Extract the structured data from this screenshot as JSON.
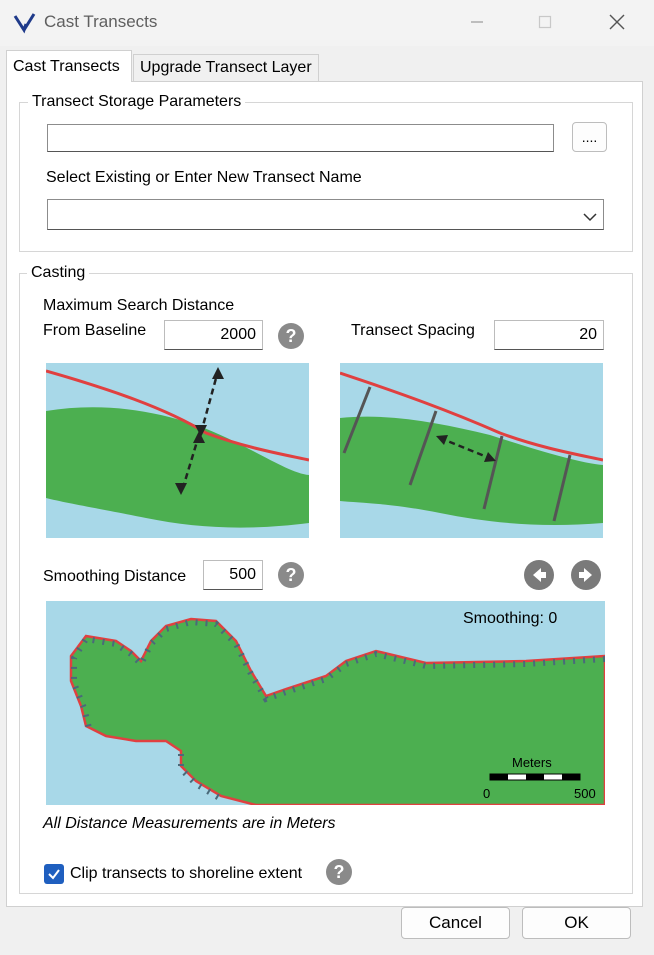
{
  "window": {
    "title": "Cast Transects",
    "app_icon": "dsas-logo-icon",
    "controls": [
      "minimize-icon",
      "maximize-icon",
      "close-icon"
    ]
  },
  "tabs": [
    {
      "label": "Cast Transects",
      "selected": true
    },
    {
      "label": "Upgrade Transect Layer",
      "selected": false
    }
  ],
  "storage": {
    "group_label": "Transect Storage Parameters",
    "path_value": "",
    "browse_label": "....",
    "name_label": "Select Existing or Enter New Transect Name",
    "name_value": ""
  },
  "casting": {
    "group_label": "Casting",
    "max_search_label_1": "Maximum Search Distance",
    "max_search_label_2": "From Baseline",
    "max_search_value": "2000",
    "spacing_label": "Transect Spacing",
    "spacing_value": "20",
    "smoothing_label": "Smoothing Distance",
    "smoothing_value": "500",
    "help_glyph": "?",
    "smoothing_caption": "Smoothing: 0",
    "scale_title": "Meters",
    "scale_min": "0",
    "scale_max": "500",
    "note": "All Distance Measurements are in Meters",
    "clip_label": "Clip transects to shoreline extent",
    "clip_checked": true
  },
  "buttons": {
    "cancel": "Cancel",
    "ok": "OK"
  },
  "colors": {
    "water": "#a8d8e8",
    "land": "#4caf50",
    "baseline": "#e04040",
    "checkbox": "#1f5fbf"
  }
}
